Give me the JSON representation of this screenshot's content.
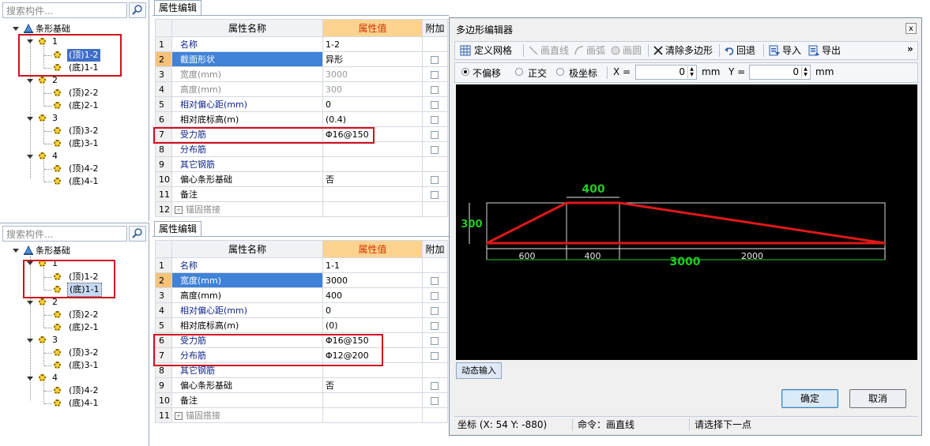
{
  "top_tree": {
    "search_placeholder": "搜索构件...",
    "root": "条形基础",
    "groups": [
      {
        "id": "1",
        "children": [
          "(顶)1-2",
          "(底)1-1"
        ]
      },
      {
        "id": "2",
        "children": [
          "(顶)2-2",
          "(底)2-1"
        ]
      },
      {
        "id": "3",
        "children": [
          "(顶)3-2",
          "(底)3-1"
        ]
      },
      {
        "id": "4",
        "children": [
          "(顶)4-2",
          "(底)4-1"
        ]
      }
    ],
    "selected": "(顶)1-2"
  },
  "bottom_tree": {
    "search_placeholder": "搜索构件...",
    "root": "条形基础",
    "groups": [
      {
        "id": "1",
        "children": [
          "(顶)1-2",
          "(底)1-1"
        ]
      },
      {
        "id": "2",
        "children": [
          "(顶)2-2",
          "(底)2-1"
        ]
      },
      {
        "id": "3",
        "children": [
          "(顶)3-2",
          "(底)3-1"
        ]
      },
      {
        "id": "4",
        "children": [
          "(顶)4-2",
          "(底)4-1"
        ]
      }
    ],
    "selected": "(底)1-1"
  },
  "top_grid": {
    "tab": "属性编辑",
    "headers": {
      "name": "属性名称",
      "value": "属性值",
      "extra": "附加"
    },
    "rows": [
      {
        "n": "1",
        "name": "名称",
        "value": "1-2"
      },
      {
        "n": "2",
        "name": "截面形状",
        "value": "异形"
      },
      {
        "n": "3",
        "name": "宽度(mm)",
        "value": "3000"
      },
      {
        "n": "4",
        "name": "高度(mm)",
        "value": "300"
      },
      {
        "n": "5",
        "name": "相对偏心距(mm)",
        "value": "0"
      },
      {
        "n": "6",
        "name": "相对底标高(m)",
        "value": "(0.4)"
      },
      {
        "n": "7",
        "name": "受力筋",
        "value": "Φ16@150"
      },
      {
        "n": "8",
        "name": "分布筋",
        "value": ""
      },
      {
        "n": "9",
        "name": "其它钢筋",
        "value": ""
      },
      {
        "n": "10",
        "name": "偏心条形基础",
        "value": "否"
      },
      {
        "n": "11",
        "name": "备注",
        "value": ""
      },
      {
        "n": "12",
        "name": "锚固搭接",
        "value": ""
      }
    ]
  },
  "bottom_grid": {
    "tab": "属性编辑",
    "headers": {
      "name": "属性名称",
      "value": "属性值",
      "extra": "附加"
    },
    "rows": [
      {
        "n": "1",
        "name": "名称",
        "value": "1-1"
      },
      {
        "n": "2",
        "name": "宽度(mm)",
        "value": "3000"
      },
      {
        "n": "3",
        "name": "高度(mm)",
        "value": "400"
      },
      {
        "n": "4",
        "name": "相对偏心距(mm)",
        "value": "0"
      },
      {
        "n": "5",
        "name": "相对底标高(m)",
        "value": "(0)"
      },
      {
        "n": "6",
        "name": "受力筋",
        "value": "Φ16@150"
      },
      {
        "n": "7",
        "name": "分布筋",
        "value": "Φ12@200"
      },
      {
        "n": "8",
        "name": "其它钢筋",
        "value": ""
      },
      {
        "n": "9",
        "name": "偏心条形基础",
        "value": "否"
      },
      {
        "n": "10",
        "name": "备注",
        "value": ""
      },
      {
        "n": "11",
        "name": "锚固搭接",
        "value": ""
      }
    ]
  },
  "dialog": {
    "title": "多边形编辑器",
    "close": "x",
    "toolbar": {
      "define_grid": "定义网格",
      "line": "画直线",
      "arc": "画弧",
      "circle": "画圆",
      "clear": "清除多边形",
      "undo": "回退",
      "import": "导入",
      "export": "导出",
      "more": "»"
    },
    "options": {
      "no_offset": "不偏移",
      "ortho": "正交",
      "polar": "极坐标",
      "x_label": "X =",
      "x_value": "0",
      "x_unit": "mm",
      "y_label": "Y =",
      "y_value": "0",
      "y_unit": "mm"
    },
    "drawing": {
      "top_dim": "400",
      "left_dim": "300",
      "seg_dims": [
        "600",
        "400",
        "2000"
      ],
      "total_dim": "3000"
    },
    "dynamic_input": "动态输入",
    "ok": "确定",
    "cancel": "取消",
    "status": {
      "coords": "坐标 (X: 54 Y: -880)",
      "command": "命令：画直线",
      "prompt": "请选择下一点"
    }
  },
  "colors": {
    "highlight": "#d0101e",
    "selection": "#3f6ec8",
    "value_header": "#fbd28e",
    "dim_green": "#22cc22",
    "poly_red": "#e01818"
  }
}
